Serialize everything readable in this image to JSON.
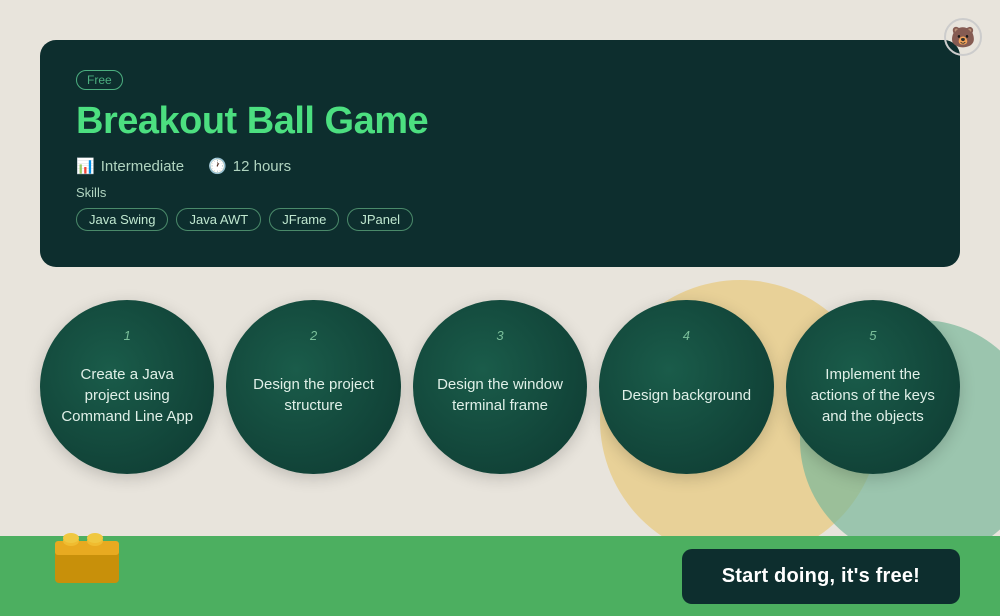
{
  "bear_icon": "🐻",
  "card": {
    "badge": "Free",
    "title": "Breakout Ball Game",
    "level_icon": "📊",
    "level": "Intermediate",
    "time_icon": "🕐",
    "time": "12 hours",
    "skills_label": "Skills",
    "skills": [
      "Java Swing",
      "Java AWT",
      "JFrame",
      "JPanel"
    ]
  },
  "steps": [
    {
      "number": "1",
      "text": "Create a Java project using Command Line App"
    },
    {
      "number": "2",
      "text": "Design the project structure"
    },
    {
      "number": "3",
      "text": "Design the window terminal frame"
    },
    {
      "number": "4",
      "text": "Design background"
    },
    {
      "number": "5",
      "text": "Implement the actions of the keys and the objects"
    }
  ],
  "cta_button": "Start doing, it's free!"
}
